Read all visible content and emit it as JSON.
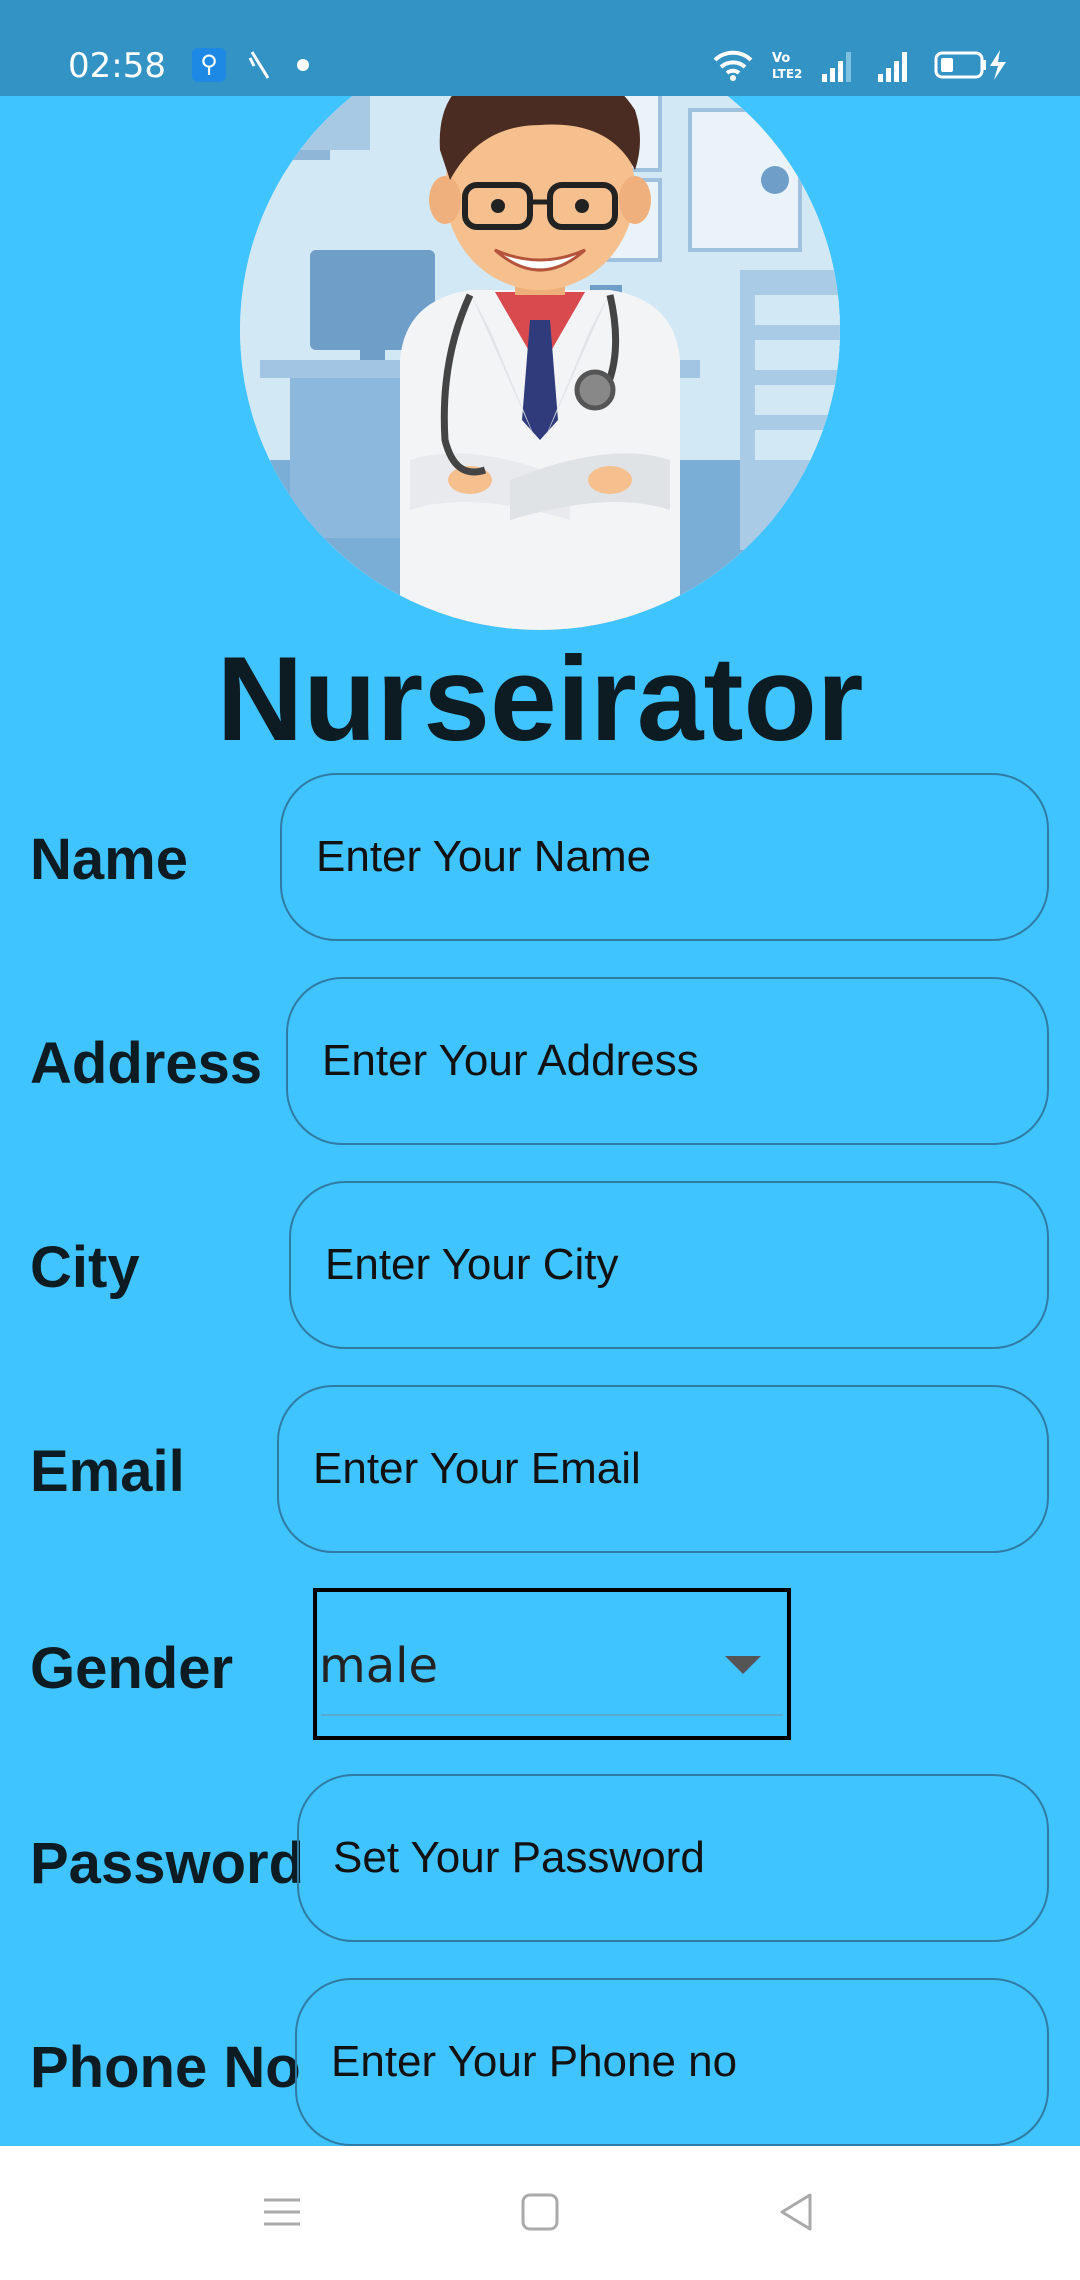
{
  "status_bar": {
    "time": "02:58",
    "icons": [
      "usb-icon",
      "missed-call-icon",
      "notification-dot-icon",
      "wifi-icon",
      "volte-lte2-icon",
      "signal-sim1-icon",
      "signal-sim2-icon",
      "battery-charging-icon"
    ],
    "volte_text": "VoLTE2"
  },
  "header": {
    "logo_alt": "doctor-illustration",
    "app_title": "Nurseirator"
  },
  "form": {
    "name": {
      "label": "Name",
      "placeholder": "Enter Your Name"
    },
    "address": {
      "label": "Address",
      "placeholder": "Enter Your Address"
    },
    "city": {
      "label": "City",
      "placeholder": "Enter Your City"
    },
    "email": {
      "label": "Email",
      "placeholder": "Enter Your Email"
    },
    "gender": {
      "label": "Gender",
      "selected": "male"
    },
    "password": {
      "label": "Password",
      "placeholder": "Set Your Password"
    },
    "phone": {
      "label": "Phone No",
      "placeholder": "Enter Your Phone no"
    }
  },
  "nav_bar": {
    "buttons": [
      "menu-icon",
      "home-icon",
      "back-icon"
    ]
  },
  "colors": {
    "background": "#40c4ff",
    "status_bar": "#3293c4",
    "input_border": "#2f7ba5",
    "title_text": "#0d1b22"
  }
}
